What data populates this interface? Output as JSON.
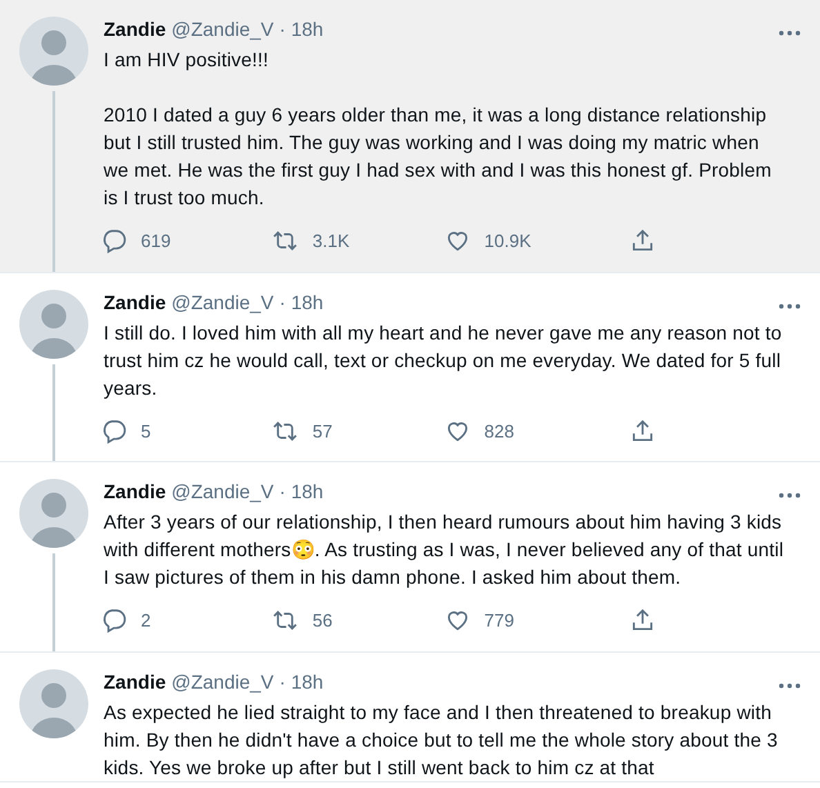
{
  "tweets": [
    {
      "name": "Zandie",
      "handle": "@Zandie_V",
      "time": "· 18h",
      "highlighted": true,
      "text": "I am HIV positive!!!\n\n2010 I dated a guy 6 years older than me, it was a long distance relationship but I still trusted him. The guy was working and I was doing my matric when we met. He was the first guy I had sex with and I was this honest gf. Problem is I trust too much.",
      "replies": "619",
      "retweets": "3.1K",
      "likes": "10.9K"
    },
    {
      "name": "Zandie",
      "handle": "@Zandie_V",
      "time": "· 18h",
      "highlighted": false,
      "text": "I still do. I loved him with all my heart and he never gave me any reason not to trust him cz he would call, text or checkup on me everyday. We dated for 5 full years.",
      "replies": "5",
      "retweets": "57",
      "likes": "828"
    },
    {
      "name": "Zandie",
      "handle": "@Zandie_V",
      "time": "· 18h",
      "highlighted": false,
      "text": "After 3 years of our relationship, I then heard rumours about him having 3 kids with different mothers😳. As trusting as I was, I never believed any of that until I saw pictures of them in his damn phone. I asked him about them.",
      "replies": "2",
      "retweets": "56",
      "likes": "779"
    },
    {
      "name": "Zandie",
      "handle": "@Zandie_V",
      "time": "· 18h",
      "highlighted": false,
      "text": "As expected he lied straight to my face and I then threatened to breakup with him. By then he didn't have a choice but to tell me the whole story about the 3 kids. Yes we broke up after but I still went back to him cz at that"
    }
  ]
}
